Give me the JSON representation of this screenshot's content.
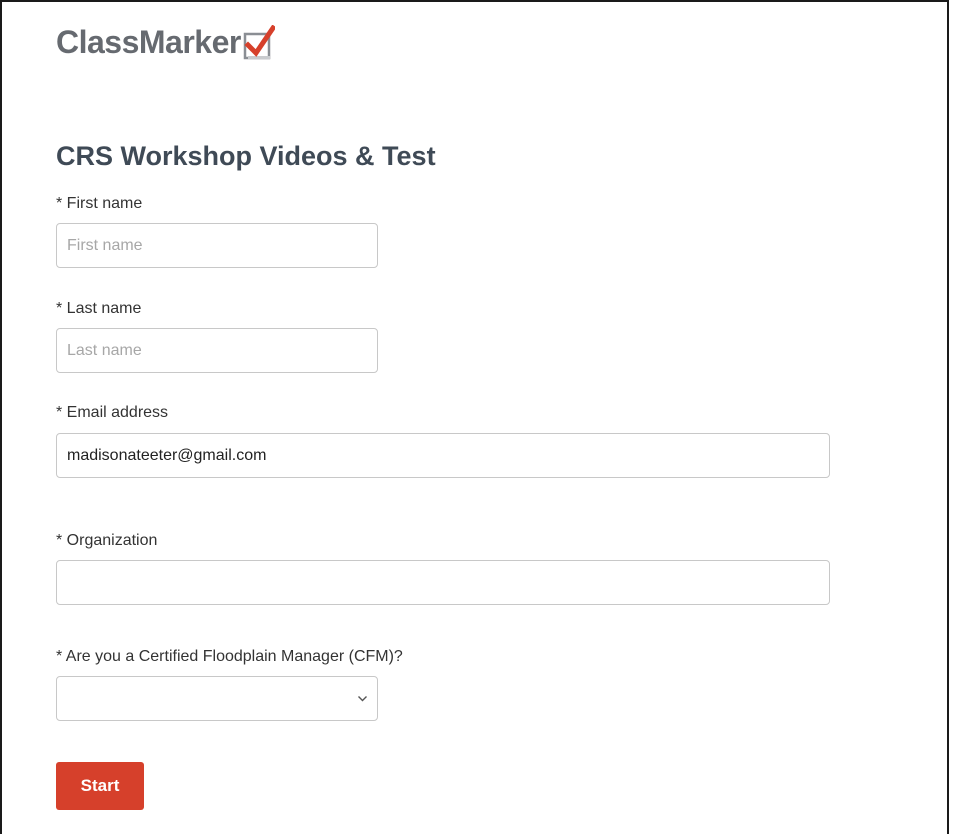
{
  "brand": {
    "name": "ClassMarker",
    "icon": "checkbox-check-icon",
    "colors": {
      "text": "#666a70",
      "check": "#d6402b"
    }
  },
  "page": {
    "title": "CRS Workshop Videos & Test"
  },
  "form": {
    "first_name": {
      "label": "* First name",
      "placeholder": "First name",
      "value": ""
    },
    "last_name": {
      "label": "* Last name",
      "placeholder": "Last name",
      "value": ""
    },
    "email": {
      "label": "* Email address",
      "placeholder": "",
      "value": "madisonateeter@gmail.com"
    },
    "organization": {
      "label": "* Organization",
      "placeholder": "",
      "value": ""
    },
    "cfm": {
      "label": "* Are you a Certified Floodplain Manager (CFM)?",
      "selected": "",
      "icon": "chevron-down-icon"
    },
    "start_label": "Start",
    "accent": "#d6402b"
  }
}
